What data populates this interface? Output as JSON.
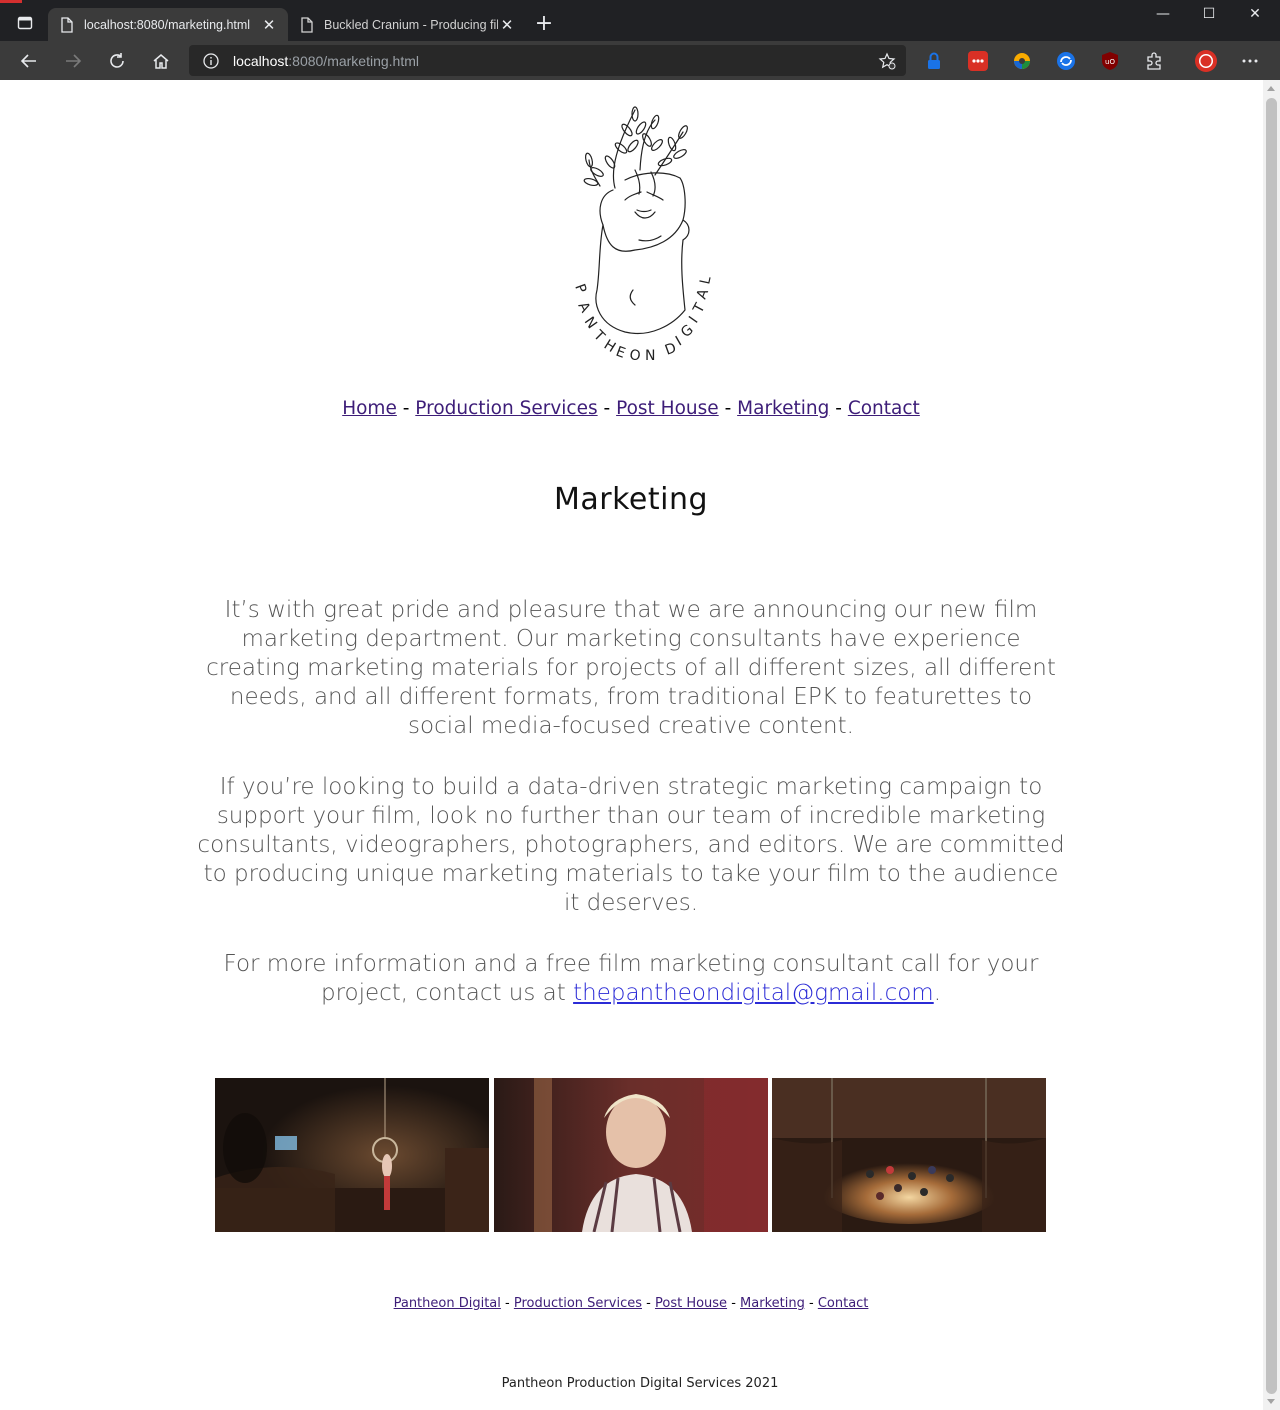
{
  "browser": {
    "tabs": [
      {
        "title": "localhost:8080/marketing.html",
        "active": true
      },
      {
        "title": "Buckled Cranium - Producing film",
        "active": false
      }
    ],
    "url_host": "localhost",
    "url_rest": ":8080/marketing.html"
  },
  "site": {
    "logo_text": "PANTHEON DIGITAL",
    "nav": {
      "home": "Home",
      "production": "Production Services",
      "post": "Post House",
      "marketing": "Marketing",
      "contact": "Contact",
      "sep": "-"
    },
    "title": "Marketing",
    "paragraphs": {
      "p1": "It’s with great pride and pleasure that we are announcing our new film marketing department. Our marketing consultants have experience creating marketing materials for projects of all different sizes, all different needs, and all different formats, from traditional EPK to featurettes to social media-focused creative content.",
      "p2": "If you’re looking to build a data-driven strategic marketing campaign to support your film, look no further than our team of incredible marketing consultants, videographers, photographers, and editors. We are committed to producing unique marketing materials to take your film to the audience it deserves.",
      "p3_before": "For more information and a free film marketing consultant call for your project, contact us at ",
      "email": "thepantheondigital@gmail.com",
      "p3_after": "."
    },
    "footer": {
      "home": "Pantheon Digital",
      "production": "Production Services",
      "post": "Post House",
      "marketing": "Marketing",
      "contact": "Contact",
      "copyright": "Pantheon Production Digital Services 2021"
    }
  }
}
